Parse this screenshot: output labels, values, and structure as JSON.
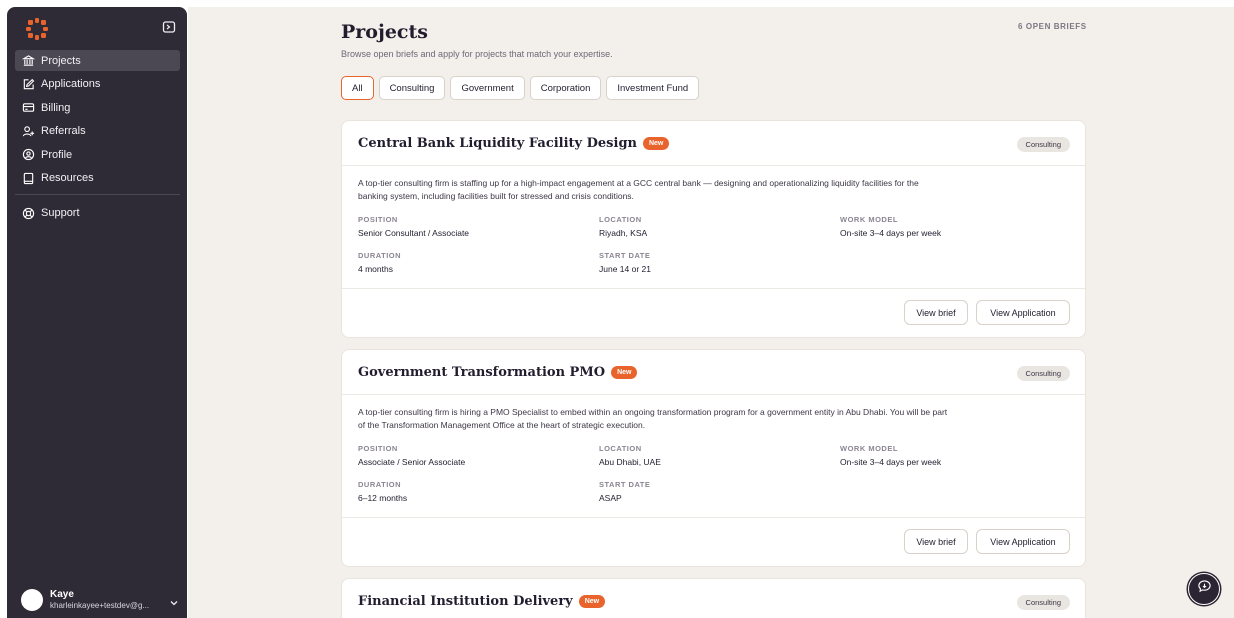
{
  "sidebar": {
    "items": [
      {
        "label": "Projects",
        "icon": "bank-icon",
        "active": true
      },
      {
        "label": "Applications",
        "icon": "edit-icon"
      },
      {
        "label": "Billing",
        "icon": "credit-card-icon"
      },
      {
        "label": "Referrals",
        "icon": "user-plus-icon"
      },
      {
        "label": "Profile",
        "icon": "user-circle-icon"
      },
      {
        "label": "Resources",
        "icon": "book-icon"
      }
    ],
    "support_label": "Support",
    "user": {
      "name": "Kaye",
      "email": "kharleinkayee+testdev@g..."
    }
  },
  "header": {
    "title": "Projects",
    "subtitle": "Browse open briefs and apply for projects that match your expertise.",
    "open_briefs": "6 OPEN BRIEFS"
  },
  "filters": [
    "All",
    "Consulting",
    "Government",
    "Corporation",
    "Investment Fund"
  ],
  "labels": {
    "new_badge": "New",
    "position": "POSITION",
    "location": "LOCATION",
    "work_model": "WORK MODEL",
    "duration": "DURATION",
    "start_date": "START DATE",
    "view_brief": "View brief",
    "view_application": "View Application"
  },
  "projects": [
    {
      "title": "Central Bank Liquidity Facility Design",
      "tag": "Consulting",
      "description": "A top-tier consulting firm is staffing up for a high-impact engagement at a GCC central bank — designing and operationalizing liquidity facilities for the banking system, including facilities built for stressed and crisis conditions.",
      "position": "Senior Consultant / Associate",
      "location": "Riyadh, KSA",
      "work_model": "On-site 3–4 days per week",
      "duration": "4 months",
      "start_date": "June 14 or 21"
    },
    {
      "title": "Government Transformation PMO",
      "tag": "Consulting",
      "description": "A top-tier consulting firm is hiring a PMO Specialist to embed within an ongoing transformation program for a government entity in Abu Dhabi. You will be part of the Transformation Management Office at the heart of strategic execution.",
      "position": "Associate / Senior Associate",
      "location": "Abu Dhabi, UAE",
      "work_model": "On-site 3–4 days per week",
      "duration": "6–12 months",
      "start_date": "ASAP"
    },
    {
      "title": "Financial Institution Delivery",
      "tag": "Consulting"
    }
  ],
  "colors": {
    "accent": "#e8642c",
    "sidebar": "#2f2b36",
    "background": "#f3efea"
  }
}
